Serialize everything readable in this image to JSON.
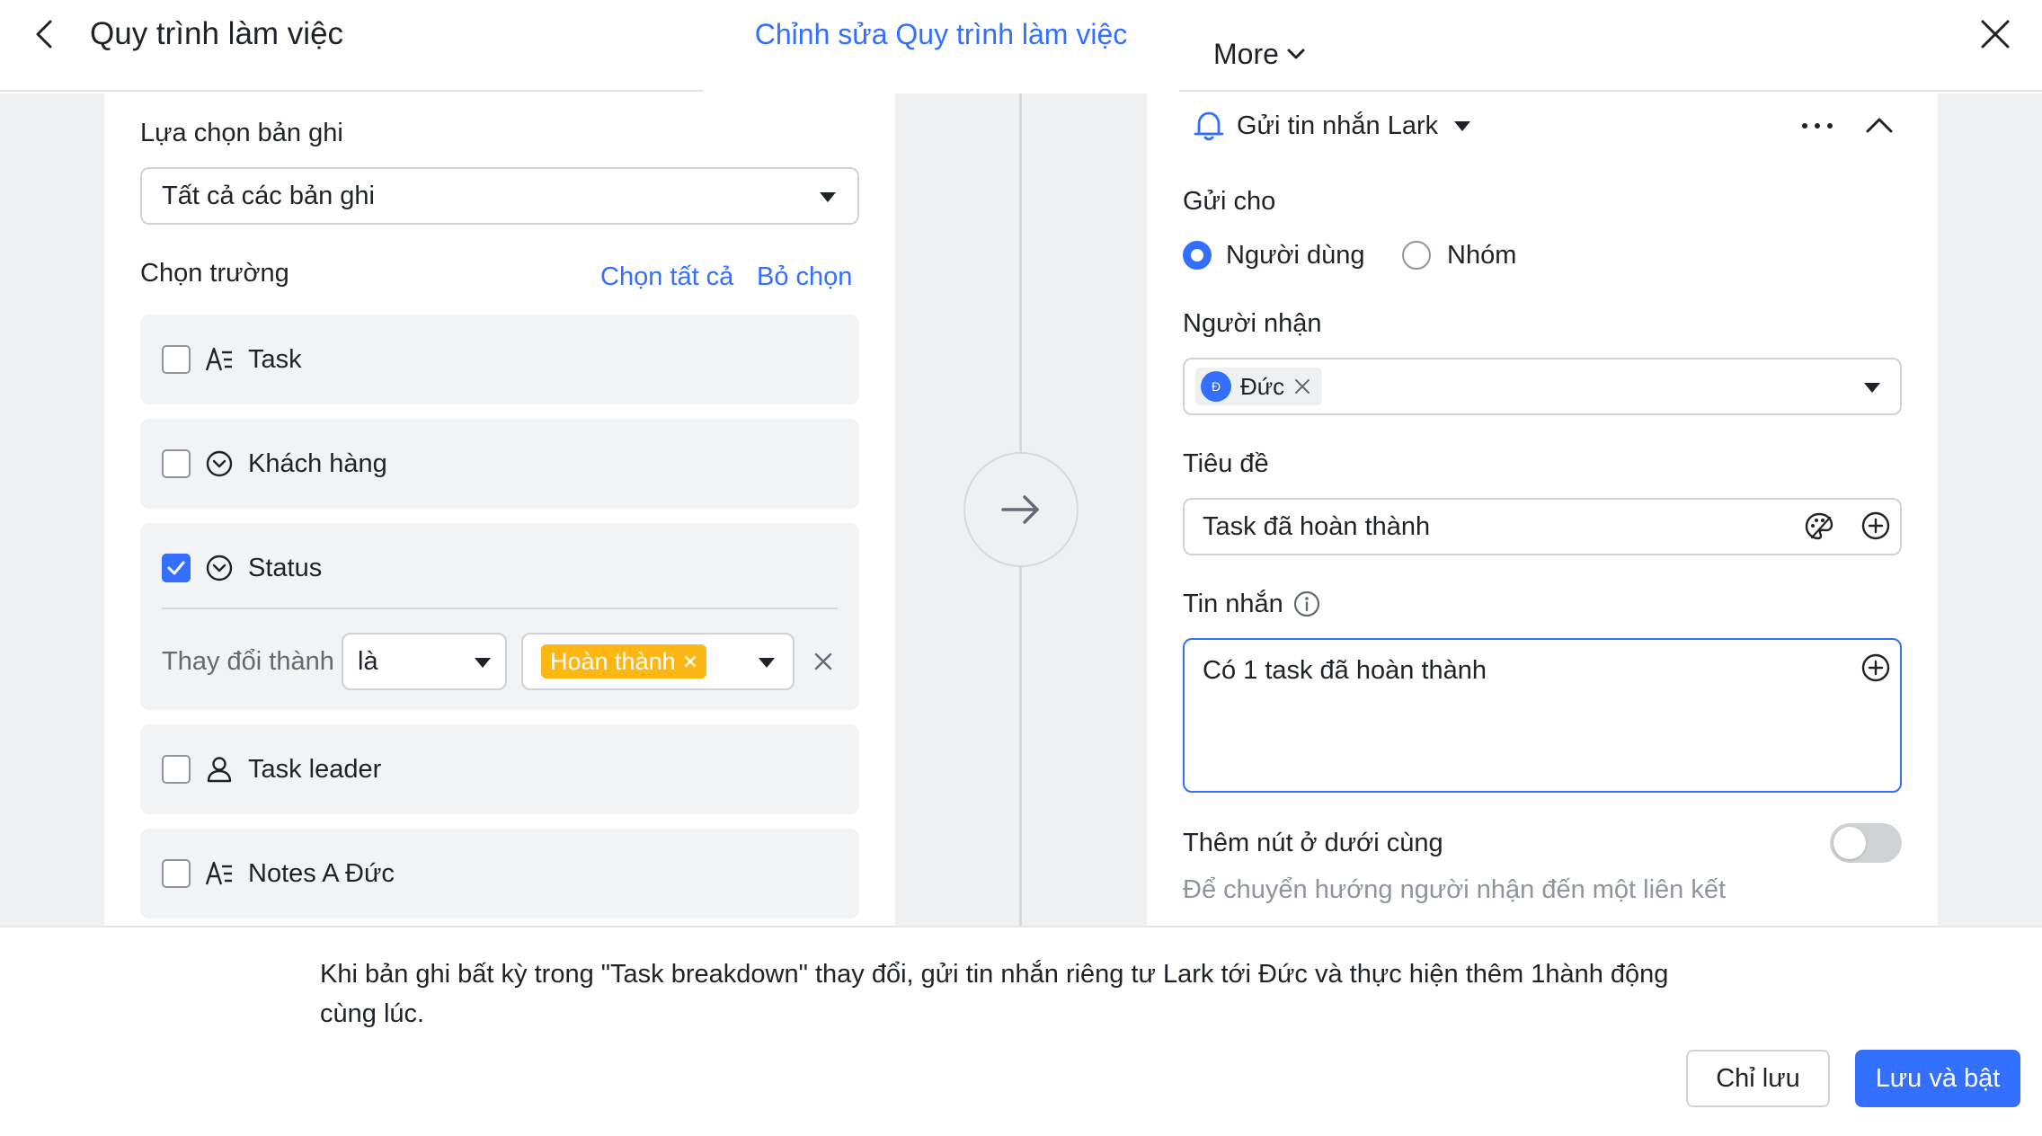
{
  "header": {
    "title": "Quy trình làm việc",
    "edit_tab": "Chỉnh sửa Quy trình làm việc",
    "more_label": "More"
  },
  "left_panel": {
    "record_select_label": "Lựa chọn bản ghi",
    "record_select_value": "Tất cả các bản ghi",
    "fields_label": "Chọn trường",
    "select_all": "Chọn tất cả",
    "deselect": "Bỏ chọn",
    "fields": [
      {
        "label": "Task",
        "checked": false,
        "icon": "text-field-icon"
      },
      {
        "label": "Khách hàng",
        "checked": false,
        "icon": "single-select-icon"
      },
      {
        "label": "Status",
        "checked": true,
        "icon": "single-select-icon"
      },
      {
        "label": "Task leader",
        "checked": false,
        "icon": "person-icon"
      },
      {
        "label": "Notes A Đức",
        "checked": false,
        "icon": "text-field-icon"
      }
    ],
    "condition": {
      "label": "Thay đổi thành",
      "operator": "là",
      "value_chip": "Hoàn thành"
    }
  },
  "right_panel": {
    "action_title": "Gửi tin nhắn Lark",
    "send_to_label": "Gửi cho",
    "radio_user": "Người dùng",
    "radio_group": "Nhóm",
    "recipient_label": "Người nhận",
    "recipient": {
      "avatar": "Đ",
      "name": "Đức"
    },
    "subject_label": "Tiêu đề",
    "subject_value": "Task đã hoàn thành",
    "message_label": "Tin nhắn",
    "message_value": "Có 1 task đã hoàn thành",
    "bottom_button_label": "Thêm nút ở dưới cùng",
    "bottom_button_hint": "Để chuyển hướng người nhận đến một liên kết",
    "bottom_button_enabled": false
  },
  "footer": {
    "summary": "Khi bản ghi bất kỳ trong \"Task breakdown\" thay đổi, gửi tin nhắn riêng tư Lark tới Đức và thực hiện thêm 1hành động cùng lúc.",
    "save_only": "Chỉ lưu",
    "save_enable": "Lưu và bật"
  },
  "colors": {
    "accent": "#3370ff",
    "chip_yellow": "#fcb714",
    "canvas_bg": "#eff0f1"
  }
}
